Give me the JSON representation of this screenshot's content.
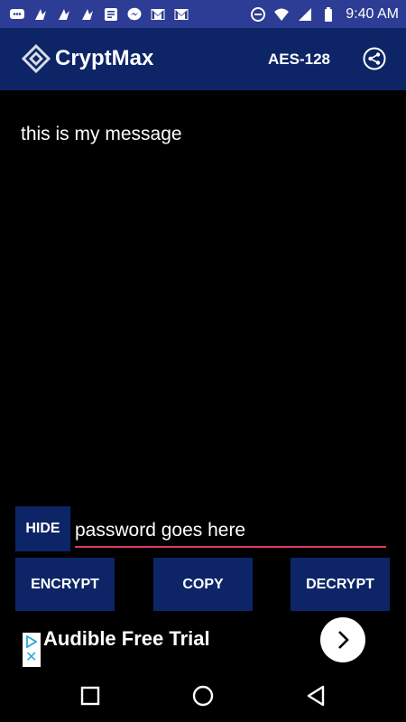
{
  "status_bar": {
    "time": "9:40 AM",
    "left_icons": [
      "chat-icon",
      "sms-icon",
      "sms-icon",
      "sms-icon",
      "news-icon",
      "messenger-icon",
      "gmail-icon",
      "gmail-icon"
    ],
    "right_icons": [
      "dnd-icon",
      "wifi-icon",
      "signal-icon",
      "battery-icon"
    ]
  },
  "app_bar": {
    "title": "CryptMax",
    "algorithm": "AES-128",
    "share_icon": "share-icon"
  },
  "message": {
    "text": "this is my message"
  },
  "password": {
    "hide_label": "HIDE",
    "placeholder": "password goes here",
    "value": ""
  },
  "actions": {
    "encrypt_label": "ENCRYPT",
    "copy_label": "COPY",
    "decrypt_label": "DECRYPT"
  },
  "ad": {
    "text": "Audible Free Trial",
    "cta_icon": "chevron-right-icon",
    "choices_icon": "adchoices-icon"
  },
  "nav": {
    "recents_icon": "square-icon",
    "home_icon": "circle-icon",
    "back_icon": "triangle-back-icon"
  },
  "colors": {
    "status_bar": "#2d3c94",
    "app_bar": "#0d2567",
    "button": "#0d2567",
    "accent_underline": "#e0336c",
    "background": "#000000"
  }
}
